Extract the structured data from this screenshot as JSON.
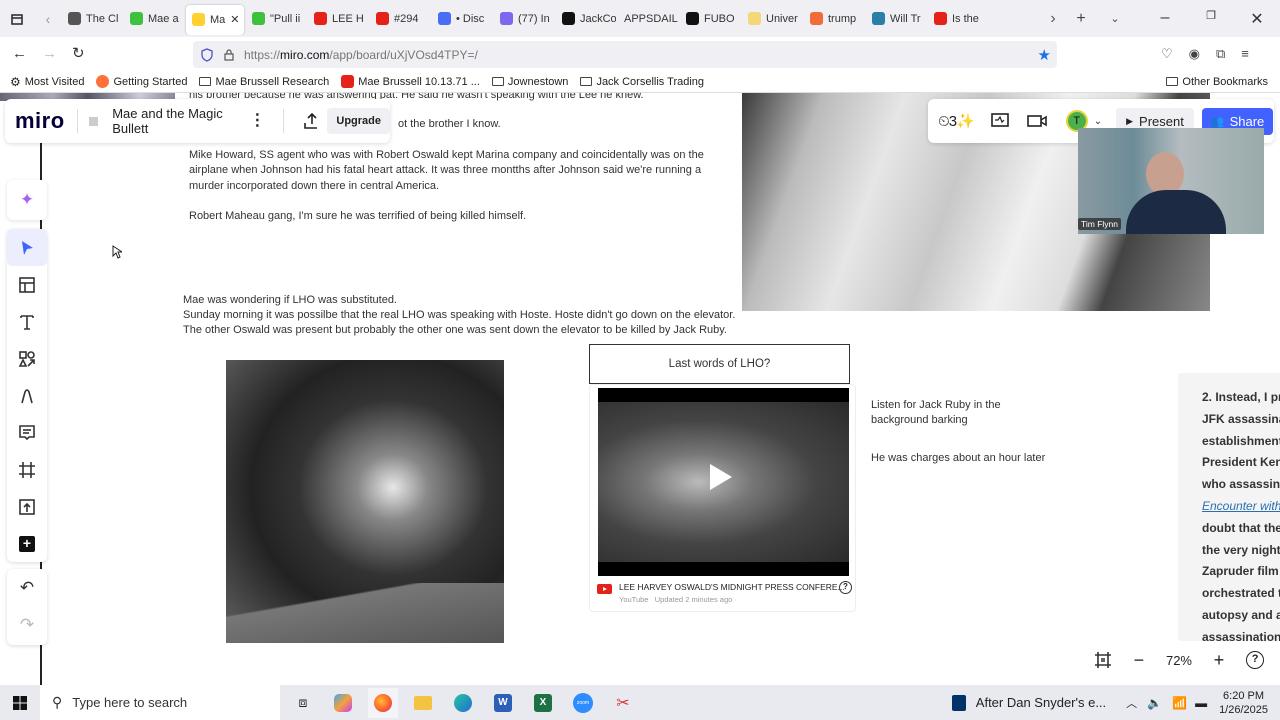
{
  "browser": {
    "tabs": [
      {
        "label": "The Cl",
        "color": "#555"
      },
      {
        "label": "Mae a",
        "color": "#3ec13e"
      },
      {
        "label": "Ma",
        "color": "#ffd02f",
        "active": true
      },
      {
        "label": "\"Pull ii",
        "color": "#3ec13e"
      },
      {
        "label": "LEE H",
        "color": "#e62117"
      },
      {
        "label": "#294",
        "color": "#e62117"
      },
      {
        "label": "• Disc",
        "color": "#4a6cf7"
      },
      {
        "label": "(77) In",
        "color": "#7b68ee"
      },
      {
        "label": "JackCo",
        "color": "#111"
      },
      {
        "label": "APPSDAIL",
        "color": ""
      },
      {
        "label": "FUBO",
        "color": "#111"
      },
      {
        "label": "Univer",
        "color": "#f5d77a"
      },
      {
        "label": "trump",
        "color": "#f26b3a"
      },
      {
        "label": "Will Tr",
        "color": "#2a7fa8"
      },
      {
        "label": "Is the",
        "color": "#e62117"
      }
    ],
    "url_prefix": "https://",
    "url_domain": "miro.com",
    "url_path": "/app/board/uXjVOsd4TPY=/",
    "bookmarks": [
      {
        "label": "Most Visited",
        "icon": "gear-icon"
      },
      {
        "label": "Getting Started",
        "icon": "firefox-icon"
      },
      {
        "label": "Mae Brussell Research",
        "icon": "folder-icon"
      },
      {
        "label": "Mae Brussell 10.13.71 ...",
        "icon": "youtube-icon"
      },
      {
        "label": "Jownestown",
        "icon": "folder-icon"
      },
      {
        "label": "Jack Corsellis Trading",
        "icon": "folder-icon"
      }
    ],
    "other_bookmarks": "Other Bookmarks"
  },
  "miro": {
    "logo": "miro",
    "board_name": "Mae and the Magic Bullett",
    "upgrade_label": "Upgrade",
    "present_label": "Present",
    "share_label": "Share",
    "avatar_initial": "T",
    "zoom_level": "72%",
    "video_caller": "Tim Flynn"
  },
  "board": {
    "text_top_partial": "his brother because he was answering pat. He said he wasn't speaking with the Lee he knew.",
    "text_brother": "ot the brother I know.",
    "text_howard": "Mike Howard, SS agent who was with Robert Oswald kept Marina company and coincidentally  was on the airplane when Johnson had his fatal heart attack.  It was three montths after Johnson said we're running a murder incorporated down there in central America.",
    "text_maheau": "Robert Maheau gang, I'm sure he was terrified of being killed himself.",
    "text_mae_wondering": "Mae was wondering if LHO was substituted.",
    "text_sunday": "Sunday morning it was possilbe that the real LHO was speaking with Hoste. Hoste didn't go down on the elevator.  The other Oswald was present but probably the other one was sent down the elevator to be killed by Jack Ruby.",
    "last_words_label": "Last words of LHO?",
    "video_title": "LEE HARVEY OSWALD'S MIDNIGHT PRESS CONFERE...",
    "video_source": "YouTube",
    "video_updated": "Updated 2 minutes ago",
    "text_listen": "Listen for Jack Ruby in the background barking",
    "text_charges": "He was charges about an hour later",
    "right_doc_lines": [
      "2. Instead, I pr",
      "JFK assassinat",
      "establishment",
      "President Ken",
      "who assassina",
      "Encounter with",
      "doubt that the",
      "the very night",
      "Zapruder film",
      "orchestrated t",
      "autopsy and a",
      "assassination"
    ]
  },
  "taskbar": {
    "search_placeholder": "Type here to search",
    "news_text": "After Dan Snyder's e...",
    "time": "6:20 PM",
    "date": "1/26/2025"
  }
}
